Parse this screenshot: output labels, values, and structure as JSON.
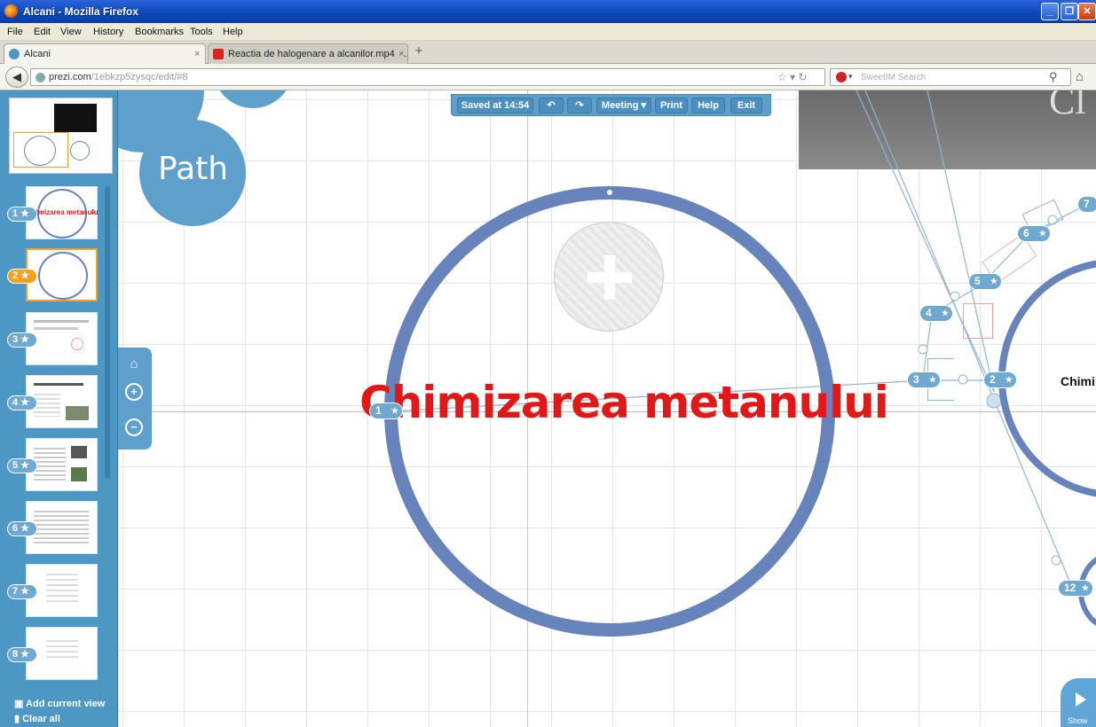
{
  "window": {
    "title": "Alcani - Mozilla Firefox"
  },
  "menu": {
    "items": [
      "File",
      "Edit",
      "View",
      "History",
      "Bookmarks",
      "Tools",
      "Help"
    ]
  },
  "tabs": [
    {
      "label": "Alcani",
      "close": "×"
    },
    {
      "label": "Reactia de halogenare a alcanilor.mp4 - ...",
      "close": "×"
    }
  ],
  "newtab": "+",
  "nav": {
    "url_host": "prezi.com",
    "url_path": "/1ebkzp5zysqc/edit/#8",
    "search_placeholder": "SweetIM Search"
  },
  "editbar": {
    "saved": "Saved at 14:54",
    "undo": "↶",
    "redo": "↷",
    "meeting": "Meeting ▾",
    "print": "Print",
    "help": "Help",
    "exit": "Exit"
  },
  "canvas": {
    "path_label": "Path",
    "main_title": "Chimizarea metanului",
    "right_label": "Chimi",
    "top_text": "Cl",
    "show_label": "Show"
  },
  "panel": {
    "thumbs": [
      {
        "num": "1",
        "caption": "Chimizarea metanului"
      },
      {
        "num": "2",
        "caption": ""
      },
      {
        "num": "3",
        "caption": ""
      },
      {
        "num": "4",
        "caption": ""
      },
      {
        "num": "5",
        "caption": ""
      },
      {
        "num": "6",
        "caption": ""
      },
      {
        "num": "7",
        "caption": ""
      },
      {
        "num": "8",
        "caption": ""
      }
    ],
    "add_view": "Add current view",
    "clear_all": "Clear all"
  },
  "path_nodes": [
    "1",
    "2",
    "3",
    "4",
    "5",
    "6",
    "7",
    "12"
  ],
  "colors": {
    "accent": "#5f9fcb",
    "ring": "#6783bb",
    "title_red": "#e21818",
    "selected": "#f4a120"
  }
}
